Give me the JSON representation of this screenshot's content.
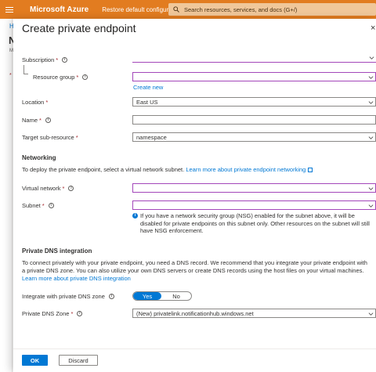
{
  "topbar": {
    "brand": "Microsoft Azure",
    "restore": "Restore default configuration",
    "search_placeholder": "Search resources, services, and docs (G+/)"
  },
  "background": {
    "crumb": "H",
    "title": "N",
    "sub": "M",
    "dot": "*"
  },
  "panel": {
    "title": "Create private endpoint",
    "close": "×",
    "subscription": {
      "label": "Subscription",
      "value": ""
    },
    "resource_group": {
      "label": "Resource group",
      "value": "",
      "create_new": "Create new"
    },
    "location": {
      "label": "Location",
      "value": "East US"
    },
    "name": {
      "label": "Name",
      "value": ""
    },
    "target": {
      "label": "Target sub-resource",
      "value": "namespace"
    },
    "networking": {
      "heading": "Networking",
      "desc": "To deploy the private endpoint, select a virtual network subnet.",
      "link": "Learn more about private endpoint networking",
      "vnet": {
        "label": "Virtual network",
        "value": ""
      },
      "subnet": {
        "label": "Subnet",
        "value": ""
      },
      "info": "If you have a network security group (NSG) enabled for the subnet above, it will be disabled for private endpoints on this subnet only. Other resources on the subnet will still have NSG enforcement."
    },
    "dns": {
      "heading": "Private DNS integration",
      "desc": "To connect privately with your private endpoint, you need a DNS record. We recommend that you integrate your private endpoint with a private DNS zone. You can also utilize your own DNS servers or create DNS records using the host files on your virtual machines.",
      "link": "Learn more about private DNS integration",
      "integrate_label": "Integrate with private DNS zone",
      "yes": "Yes",
      "no": "No",
      "zone_label": "Private DNS Zone",
      "zone_value": "(New) privatelink.notificationhub.windows.net"
    },
    "footer": {
      "ok": "OK",
      "discard": "Discard"
    }
  },
  "colors": {
    "accent": "#0078d4",
    "topbar": "#e27c20",
    "required": "#a4262c",
    "error_border": "#a347ba"
  }
}
